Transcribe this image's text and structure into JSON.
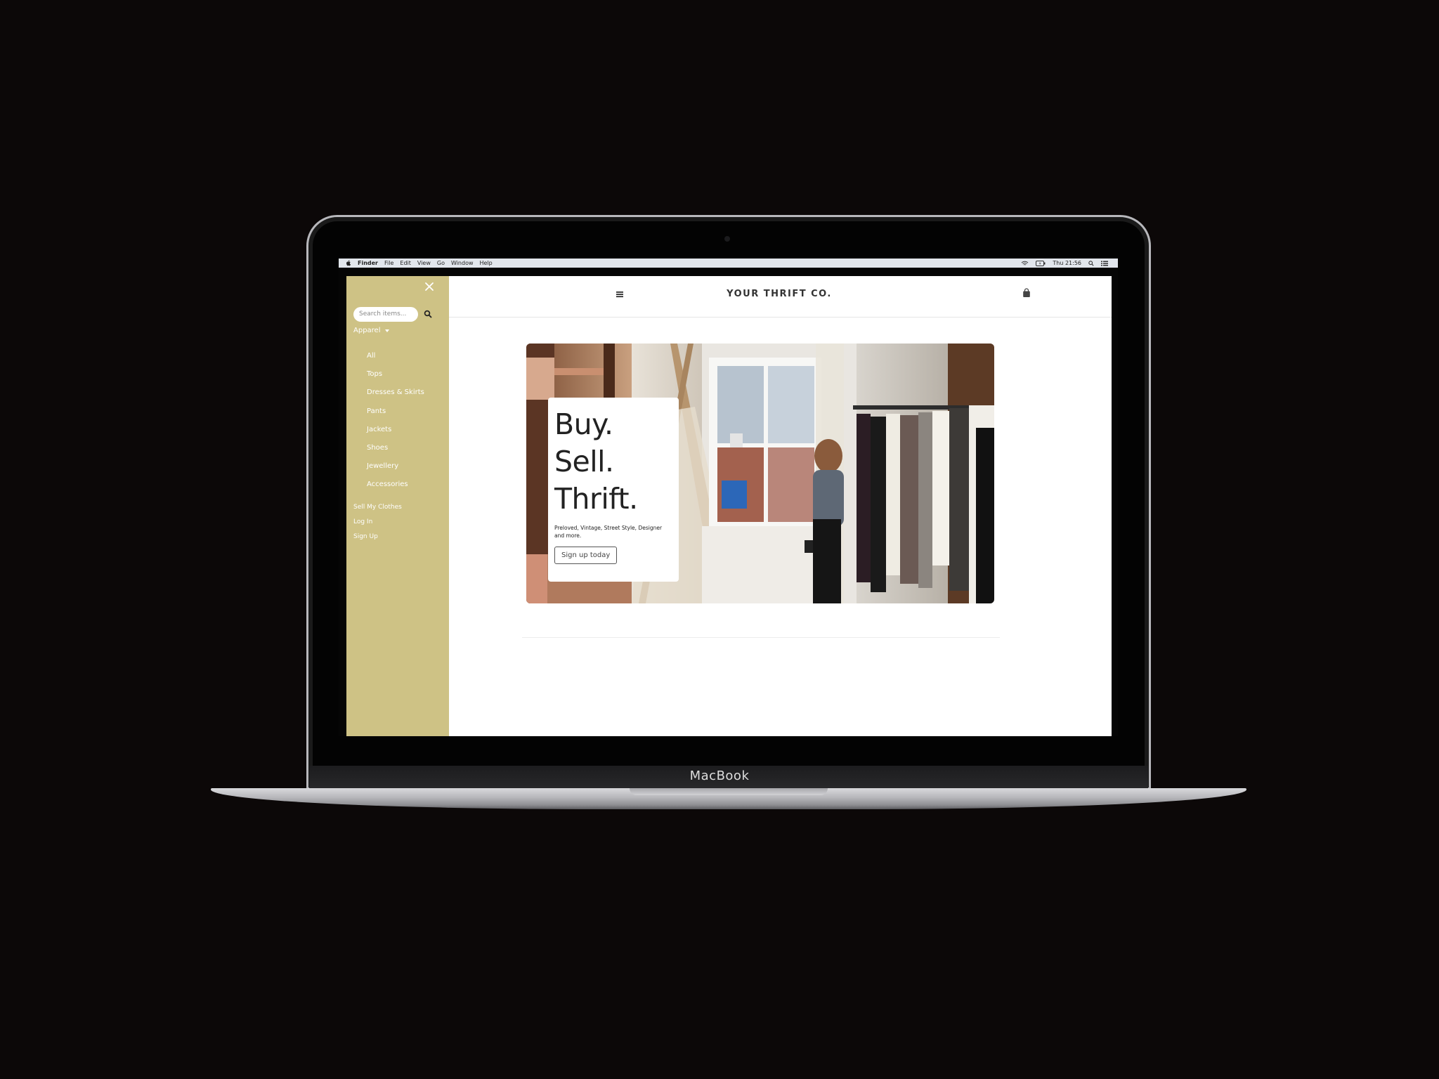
{
  "device": {
    "brand_label": "MacBook"
  },
  "menubar": {
    "app_name": "Finder",
    "items": [
      "File",
      "Edit",
      "View",
      "Go",
      "Window",
      "Help"
    ],
    "clock": "Thu 21:56"
  },
  "sidebar": {
    "search_placeholder": "Search items...",
    "category_toggle": "Apparel",
    "categories": [
      "All",
      "Tops",
      "Dresses & Skirts",
      "Pants",
      "Jackets",
      "Shoes",
      "Jewellery",
      "Accessories"
    ],
    "account_links": [
      "Sell My Clothes",
      "Log In",
      "Sign Up"
    ],
    "background_color": "#cec285"
  },
  "header": {
    "site_title": "YOUR THRIFT CO."
  },
  "hero": {
    "headline_lines": [
      "Buy.",
      "Sell.",
      "Thrift."
    ],
    "subtext": "Preloved, Vintage, Street Style, Designer and more.",
    "cta_label": "Sign up today"
  }
}
